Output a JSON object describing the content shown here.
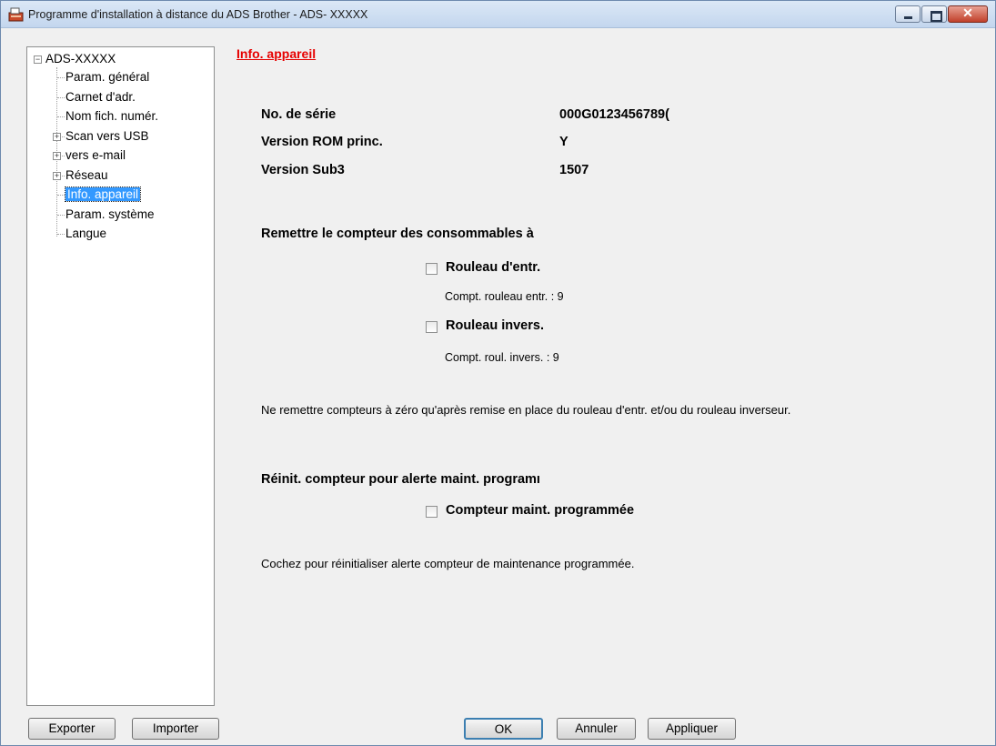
{
  "window": {
    "title": "Programme d'installation à distance du ADS Brother - ADS- XXXXX"
  },
  "tree": {
    "root": "ADS-XXXXX",
    "items": [
      {
        "label": "Param. général",
        "expandable": false
      },
      {
        "label": "Carnet d'adr.",
        "expandable": false
      },
      {
        "label": "Nom fich. numér.",
        "expandable": false
      },
      {
        "label": "Scan vers USB",
        "expandable": true
      },
      {
        "label": "vers e-mail",
        "expandable": true
      },
      {
        "label": "Réseau",
        "expandable": true
      },
      {
        "label": "Info. appareil",
        "expandable": false,
        "selected": true
      },
      {
        "label": "Param. système",
        "expandable": false
      },
      {
        "label": "Langue",
        "expandable": false
      }
    ]
  },
  "content": {
    "section_title": "Info. appareil",
    "info": [
      {
        "label": "No. de série",
        "value": "000G0123456789("
      },
      {
        "label": "Version ROM princ.",
        "value": "Y"
      },
      {
        "label": "Version Sub3",
        "value": "1507"
      }
    ],
    "reset_heading": "Remettre le compteur des consommables à",
    "roller_entry": {
      "label": "Rouleau d'entr.",
      "counter": "Compt. rouleau entr. : 9",
      "checked": false
    },
    "roller_reverse": {
      "label": "Rouleau invers.",
      "counter": "Compt. roul. invers. : 9",
      "checked": false
    },
    "reset_note": "Ne remettre compteurs à zéro qu'après remise en place du rouleau d'entr. et/ou du rouleau inverseur.",
    "maint_heading": "Réinit. compteur pour alerte maint. programı",
    "maint_counter": {
      "label": "Compteur maint. programmée",
      "checked": false
    },
    "maint_note": "Cochez pour réinitialiser alerte compteur de maintenance programmée."
  },
  "buttons": {
    "export": "Exporter",
    "import": "Importer",
    "ok": "OK",
    "cancel": "Annuler",
    "apply": "Appliquer"
  },
  "colors": {
    "selection": "#3399ff",
    "section_title": "#e60000"
  }
}
